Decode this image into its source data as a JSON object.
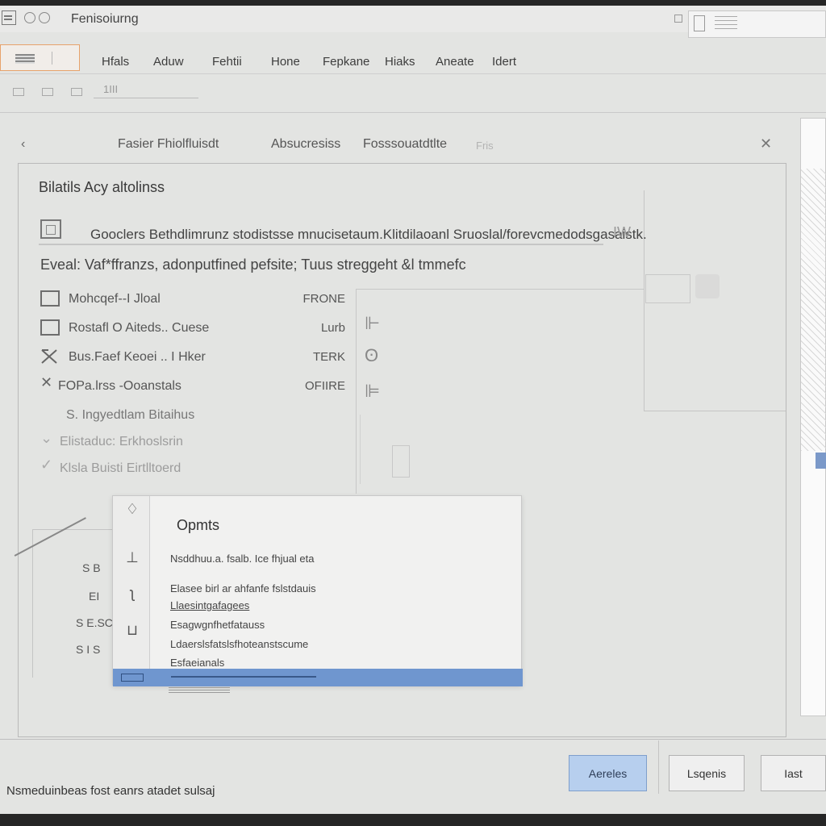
{
  "window": {
    "title": "Fenisoiurng"
  },
  "ribbon": {
    "tabs": [
      "Hfals",
      "Aduw",
      "Fehtii",
      "Hone",
      "Fepkane",
      "Hiaks",
      "Aneate",
      "Idert"
    ]
  },
  "toolbar": {
    "field_text": "1III"
  },
  "dialog": {
    "back_glyph": "‹",
    "close_glyph": "✕",
    "tabs": [
      "Fasier Fhiolfluisdt",
      "Absucresiss",
      "Fosssouatdtlte",
      "Fris"
    ],
    "section_title": "Bilatils Acy altolinss",
    "description": "Gooclers Bethdlimrunz stodistsse mnucisetaum.Klitdilaoanl Sruoslal/forevcmedodsgasaistk.",
    "description_badge": "IW",
    "summary": "Eveal: Vaf*ffranzs, adonputfined pefsite; Tuus streggeht &l tmmefc",
    "options": [
      {
        "label": "Mohcqef--I Jloal",
        "value": "FRONE"
      },
      {
        "label": "Rostafl O Aiteds.. Cuese",
        "value": "Lurb"
      },
      {
        "label": "Bus.Faef Keoei .. I Hker",
        "value": "TERK"
      },
      {
        "label": "FOPa.lrss -Ooanstals",
        "value": "OFIIRE"
      },
      {
        "label": "S. Ingyedtlam Bitaihus",
        "value": ""
      },
      {
        "label": "Elistaduc: Erkhoslsrin",
        "value": ""
      },
      {
        "label": "Klsla Buisti Eirtlltoerd",
        "value": ""
      }
    ]
  },
  "sub_panel": {
    "labels": [
      "S B",
      "EI",
      "S E.SC",
      "S I S"
    ]
  },
  "options_popup": {
    "title": "Opmts",
    "items": [
      "Nsddhuu.a. fsalb. Ice fhjual eta",
      "Elasee birl ar ahfanfe fslstdauis",
      "Llaesintgafagees",
      "Esagwgnfhetfatauss",
      "Ldaerslsfatslsfhoteanstscume",
      "Esfaeianals"
    ]
  },
  "footer": {
    "status": "Nsmeduinbeas fost eanrs atadet sulsaj",
    "buttons": [
      "Aereles",
      "Lsqenis",
      "Iast"
    ]
  },
  "colors": {
    "accent": "#6f96cf",
    "primary_button": "#b7cfee",
    "file_tab_border": "#e7a26b"
  }
}
